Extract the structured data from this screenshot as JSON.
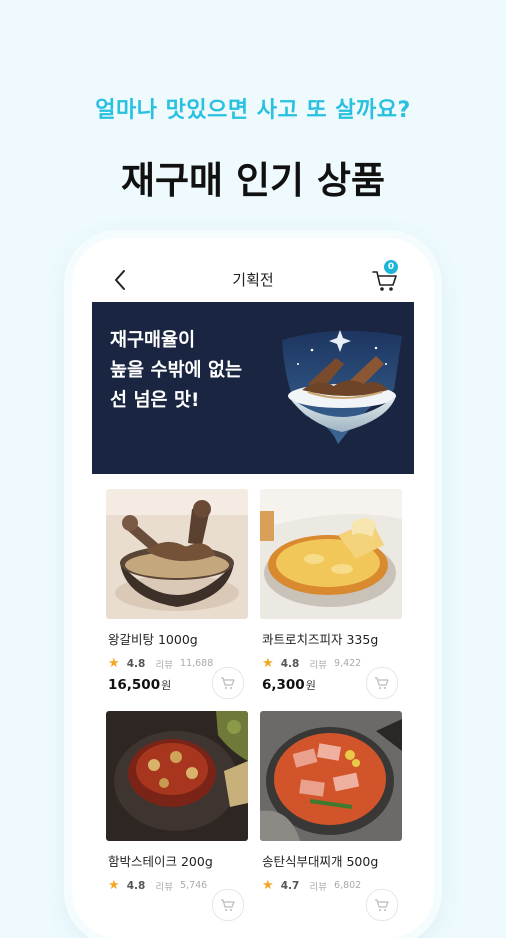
{
  "promo": {
    "subtitle": "얼마나 맛있으면 사고 또 살까요?",
    "title": "재구매 인기 상품"
  },
  "appbar": {
    "title": "기획전",
    "cart_count": "0"
  },
  "banner": {
    "text": "재구매율이\n높을 수밖에 없는\n선 넘은 맛!"
  },
  "products": [
    {
      "name": "왕갈비탕 1000g",
      "rating": "4.8",
      "review_label": "리뷰",
      "review_count": "11,688",
      "price": "16,500",
      "currency": "원"
    },
    {
      "name": "콰트로치즈피자 335g",
      "rating": "4.8",
      "review_label": "리뷰",
      "review_count": "9,422",
      "price": "6,300",
      "currency": "원"
    },
    {
      "name": "함박스테이크 200g",
      "rating": "4.8",
      "review_label": "리뷰",
      "review_count": "5,746",
      "price": "",
      "currency": ""
    },
    {
      "name": "송탄식부대찌개 500g",
      "rating": "4.7",
      "review_label": "리뷰",
      "review_count": "6,802",
      "price": "",
      "currency": ""
    }
  ],
  "colors": {
    "accent": "#29c1df",
    "background": "#eefafd",
    "banner": "#1a2541",
    "star": "#f5a623"
  },
  "icons": {
    "back": "chevron-left-icon",
    "cart": "cart-icon",
    "star": "star-icon",
    "add_to_cart": "cart-icon"
  }
}
